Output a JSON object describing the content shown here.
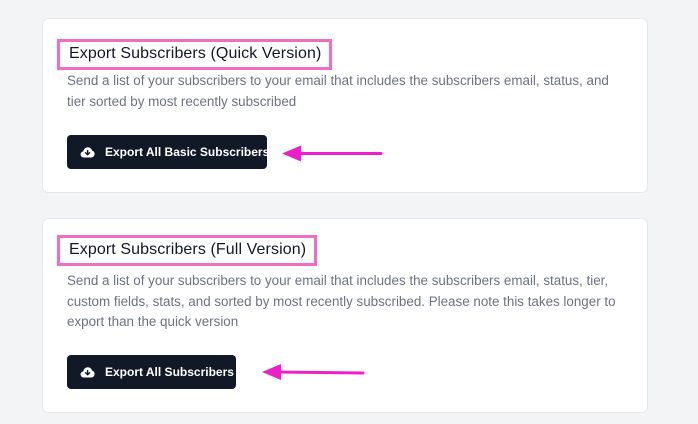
{
  "quick_export": {
    "title": "Export Subscribers (Quick Version)",
    "description": "Send a list of your subscribers to your email that includes the subscribers email, status, and tier sorted by most recently subscribed",
    "button_label": "Export All Basic Subscribers",
    "button_icon": "cloud-download-icon"
  },
  "full_export": {
    "title": "Export Subscribers (Full Version)",
    "description": "Send a list of your subscribers to your email that includes the subscribers email, status, tier, custom fields, stats, and sorted by most recently subscribed. Please note this takes longer to export than the quick version",
    "button_label": "Export All Subscribers",
    "button_icon": "cloud-download-icon"
  },
  "colors": {
    "highlight": "#f06dc4",
    "annotation_arrow": "#ee1fc8",
    "button_bg": "#111827",
    "page_bg": "#f3f4f6"
  }
}
